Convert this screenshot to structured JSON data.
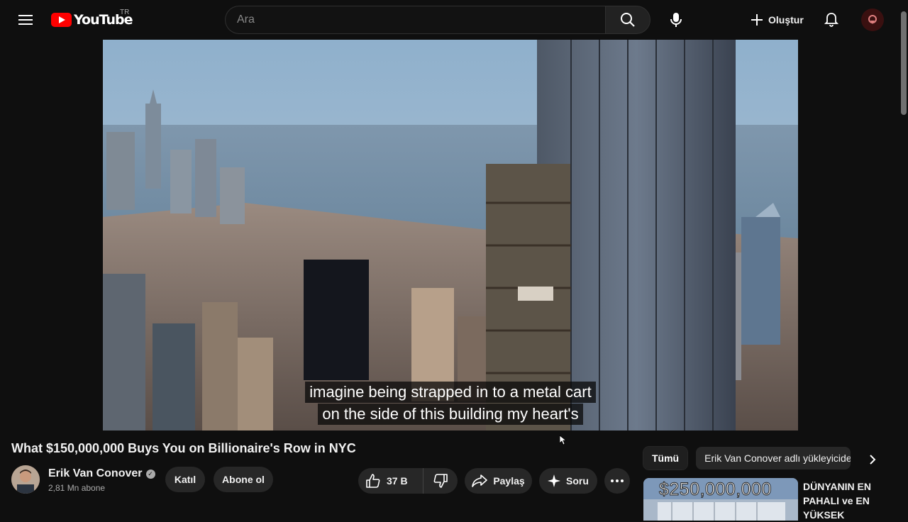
{
  "header": {
    "logo_text": "YouTube",
    "country_code": "TR",
    "search_placeholder": "Ara",
    "create_label": "Oluştur"
  },
  "player": {
    "caption_lines": [
      "imagine being strapped in to a metal cart",
      "on the side of this building my heart's"
    ]
  },
  "video": {
    "title": "What $150,000,000 Buys You on Billionaire's Row in NYC",
    "channel_name": "Erik Van Conover",
    "subscribers": "2,81 Mn abone",
    "join_label": "Katıl",
    "subscribe_label": "Abone ol",
    "like_count": "37 B",
    "share_label": "Paylaş",
    "ask_label": "Soru"
  },
  "sidebar": {
    "chips": [
      "Tümü",
      "Erik Van Conover adlı yükleyiciden"
    ],
    "recommendation": {
      "thumb_text": "$250,000,000",
      "title": "DÜNYANIN EN PAHALI ve EN YÜKSEK"
    }
  },
  "colors": {
    "background": "#0f0f0f",
    "brand_red": "#ff0000",
    "pill_bg": "#272727"
  }
}
